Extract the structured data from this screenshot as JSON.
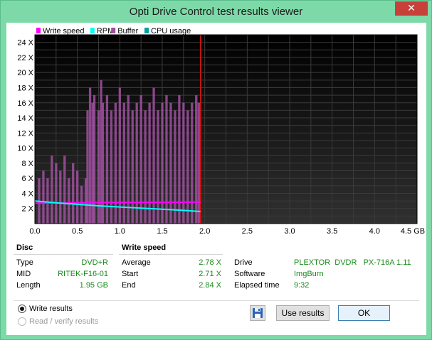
{
  "window": {
    "title": "Opti Drive Control test results viewer",
    "close_label": "✕"
  },
  "chart_data": {
    "type": "line",
    "legend": [
      {
        "name": "Write speed",
        "color": "#ff00ff"
      },
      {
        "name": "RPM",
        "color": "#00ffff"
      },
      {
        "name": "Buffer",
        "color": "#a050a0"
      },
      {
        "name": "CPU usage",
        "color": "#00a0a0"
      }
    ],
    "xlim": [
      0.0,
      4.5
    ],
    "ylim": [
      0,
      25
    ],
    "x_ticks": [
      "0.0",
      "0.5",
      "1.0",
      "1.5",
      "2.0",
      "2.5",
      "3.0",
      "3.5",
      "4.0",
      "4.5 GB"
    ],
    "y_ticks": [
      "2 X",
      "4 X",
      "6 X",
      "8 X",
      "10 X",
      "12 X",
      "14 X",
      "16 X",
      "18 X",
      "20 X",
      "22 X",
      "24 X"
    ],
    "end_marker_x": 1.95,
    "series": [
      {
        "name": "Write speed",
        "x": [
          0.0,
          0.5,
          1.0,
          1.5,
          1.95
        ],
        "y": [
          2.7,
          2.75,
          2.78,
          2.8,
          2.84
        ]
      },
      {
        "name": "RPM",
        "x": [
          0.0,
          0.25,
          0.5,
          0.75,
          1.0,
          1.25,
          1.5,
          1.75,
          1.95
        ],
        "y": [
          3.0,
          2.75,
          2.55,
          2.35,
          2.2,
          2.05,
          1.9,
          1.75,
          1.6
        ]
      }
    ],
    "buffer_x": [
      0.05,
      0.1,
      0.15,
      0.2,
      0.25,
      0.3,
      0.35,
      0.4,
      0.45,
      0.5,
      0.55,
      0.6,
      0.62,
      0.65,
      0.68,
      0.7,
      0.75,
      0.78,
      0.8,
      0.85,
      0.9,
      0.95,
      1.0,
      1.05,
      1.1,
      1.15,
      1.2,
      1.25,
      1.3,
      1.35,
      1.4,
      1.45,
      1.5,
      1.55,
      1.6,
      1.65,
      1.7,
      1.75,
      1.8,
      1.85,
      1.9,
      1.93
    ],
    "buffer_y": [
      6,
      7,
      6,
      9,
      8,
      7,
      9,
      6,
      8,
      7,
      5,
      6,
      15,
      18,
      16,
      17,
      15,
      19,
      16,
      17,
      15,
      16,
      18,
      16,
      17,
      15,
      16,
      17,
      15,
      16,
      18,
      15,
      16,
      17,
      16,
      15,
      17,
      16,
      15,
      16,
      17,
      16
    ]
  },
  "disc": {
    "heading": "Disc",
    "rows": [
      {
        "label": "Type",
        "value": "DVD+R"
      },
      {
        "label": "MID",
        "value": "RITEK-F16-01"
      },
      {
        "label": "Length",
        "value": "1.95 GB"
      }
    ]
  },
  "write_speed": {
    "heading": "Write speed",
    "rows": [
      {
        "label": "Average",
        "value": "2.78 X"
      },
      {
        "label": "Start",
        "value": "2.71 X"
      },
      {
        "label": "End",
        "value": "2.84 X"
      }
    ]
  },
  "drive_info": {
    "rows": [
      {
        "label": "Drive",
        "value": "PLEXTOR  DVDR   PX-716A 1.11"
      },
      {
        "label": "Software",
        "value": "ImgBurn"
      },
      {
        "label": "Elapsed time",
        "value": "9:32"
      }
    ]
  },
  "options": {
    "write_results": "Write results",
    "read_verify_results": "Read / verify results"
  },
  "buttons": {
    "use_results": "Use results",
    "ok": "OK",
    "save_icon": "floppy-disk-icon"
  }
}
